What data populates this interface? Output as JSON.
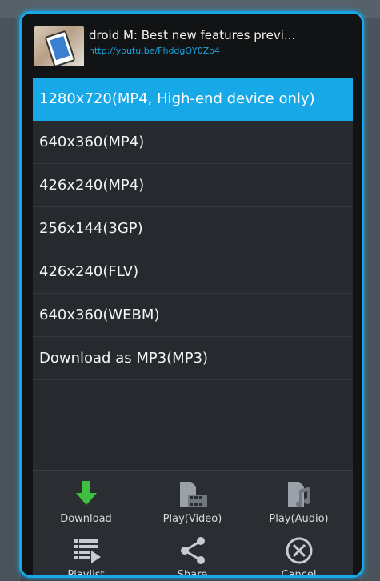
{
  "video": {
    "title": "droid M: Best new features previ...",
    "url": "http://youtu.be/FhddgQY0Zo4"
  },
  "formats": [
    {
      "label": "1280x720(MP4, High-end device only)",
      "selected": true
    },
    {
      "label": "640x360(MP4)",
      "selected": false
    },
    {
      "label": "426x240(MP4)",
      "selected": false
    },
    {
      "label": "256x144(3GP)",
      "selected": false
    },
    {
      "label": "426x240(FLV)",
      "selected": false
    },
    {
      "label": "640x360(WEBM)",
      "selected": false
    },
    {
      "label": "Download as MP3(MP3)",
      "selected": false
    }
  ],
  "actions": {
    "download": {
      "label": "Download",
      "icon": "download-icon"
    },
    "play_video": {
      "label": "Play(Video)",
      "icon": "video-icon"
    },
    "play_audio": {
      "label": "Play(Audio)",
      "icon": "music-icon"
    },
    "playlist": {
      "label": "Playlist",
      "icon": "playlist-icon"
    },
    "share": {
      "label": "Share",
      "icon": "share-icon"
    },
    "cancel": {
      "label": "Cancel",
      "icon": "cancel-icon"
    }
  },
  "colors": {
    "accent": "#17a8e8",
    "download_green": "#3fbf3f"
  }
}
